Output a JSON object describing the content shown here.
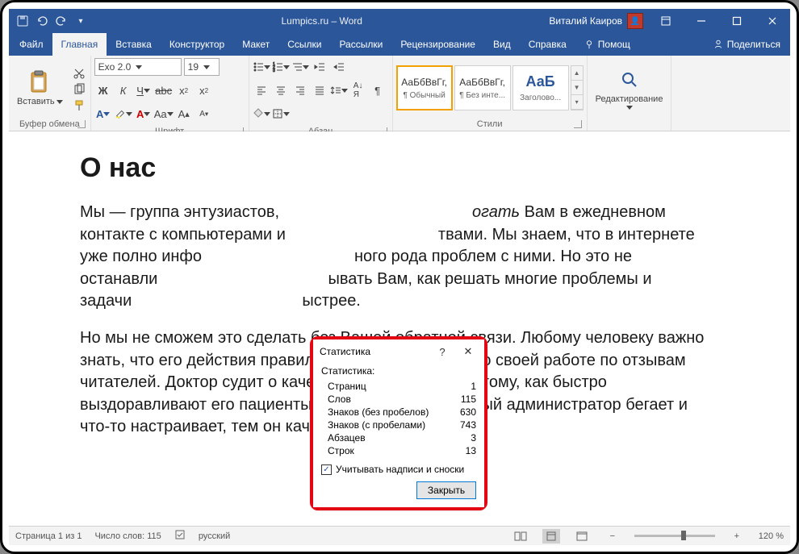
{
  "titlebar": {
    "title": "Lumpics.ru  –  Word",
    "user": "Виталий Каиров"
  },
  "menu": {
    "file": "Файл",
    "home": "Главная",
    "insert": "Вставка",
    "design": "Конструктор",
    "layout": "Макет",
    "references": "Ссылки",
    "mailings": "Рассылки",
    "review": "Рецензирование",
    "view": "Вид",
    "help": "Справка",
    "tellme": "Помощ",
    "share": "Поделиться"
  },
  "ribbon": {
    "clipboard": {
      "label": "Буфер обмена",
      "paste": "Вставить"
    },
    "font": {
      "label": "Шрифт",
      "name": "Exo 2.0",
      "size": "19"
    },
    "para": {
      "label": "Абзац"
    },
    "styles": {
      "label": "Стили",
      "preview": "АаБбВвГг,",
      "preview_big": "АаБ",
      "s1": "¶ Обычный",
      "s2": "¶ Без инте...",
      "s3": "Заголово..."
    },
    "editing": {
      "label": "Редактирование"
    }
  },
  "doc": {
    "h1": "О нас",
    "p1a": "Мы — группа энтузиастов,",
    "p1b": "огать",
    "p1c": " Вам в ежедневном контакте с компьютерами и",
    "p1d": "твами. Мы знаем, что в интернете уже полно инфо",
    "p1e": "ного рода проблем с ними. Но это не останавли",
    "p1f": "ывать Вам, как решать многие проблемы и задачи",
    "p1g": "ыстрее.",
    "p2": "Но мы не сможем это сделать без Вашей обратной связи. Любому человеку важно знать, что его действия правильные. Писатель судит о своей работе по отзывам читателей. Доктор судит о качестве своей работы по тому, как быстро выздоравливают его пациенты. Чем меньше системный администратор бегает и что-то настраивает, тем он качественнее делает"
  },
  "dialog": {
    "title": "Статистика",
    "header": "Статистика:",
    "rows": {
      "pages_k": "Страниц",
      "pages_v": "1",
      "words_k": "Слов",
      "words_v": "115",
      "chars_ns_k": "Знаков (без пробелов)",
      "chars_ns_v": "630",
      "chars_ws_k": "Знаков (с пробелами)",
      "chars_ws_v": "743",
      "paras_k": "Абзацев",
      "paras_v": "3",
      "lines_k": "Строк",
      "lines_v": "13"
    },
    "checkbox": "Учитывать надписи и сноски",
    "close": "Закрыть",
    "help": "?"
  },
  "status": {
    "page": "Страница 1 из 1",
    "words": "Число слов: 115",
    "lang": "русский",
    "zoom": "120 %"
  }
}
